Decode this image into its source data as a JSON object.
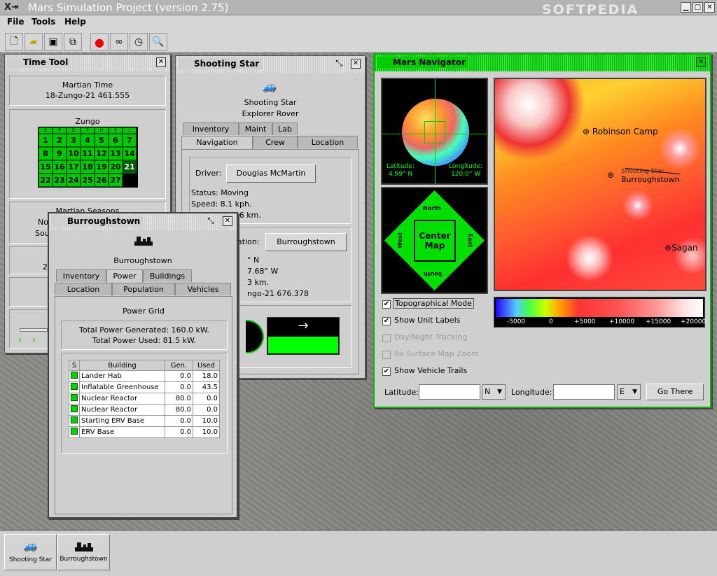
{
  "window": {
    "title": "Mars Simulation Project (version 2.75)",
    "watermark": "SOFTPEDIA"
  },
  "menu": [
    "File",
    "Tools",
    "Help"
  ],
  "toolbar": [
    {
      "icon": "new-file-icon"
    },
    {
      "icon": "open-folder-icon"
    },
    {
      "icon": "save-icon"
    },
    {
      "icon": "save-as-icon"
    },
    {
      "icon": "record-icon"
    },
    {
      "icon": "binoculars-icon"
    },
    {
      "icon": "clock-icon"
    },
    {
      "icon": "document-search-icon"
    }
  ],
  "time_tool": {
    "title": "Time Tool",
    "martian_time_label": "Martian Time",
    "martian_time_value": "18-Zungo-21  461.555",
    "month": "Zungo",
    "weekdays": [
      "S",
      "P",
      "D",
      "T",
      "H",
      "V",
      "J"
    ],
    "days": [
      [
        1,
        2,
        3,
        4,
        5,
        6,
        7
      ],
      [
        8,
        9,
        10,
        11,
        12,
        13,
        14
      ],
      [
        15,
        16,
        17,
        18,
        19,
        20,
        21
      ],
      [
        22,
        23,
        24,
        25,
        26,
        27,
        ""
      ]
    ],
    "current_day": 21,
    "seasons_label": "Martian Seasons",
    "north_abbr": "Nor",
    "south_abbr": "Sout",
    "partial_year": "20"
  },
  "shooting_star": {
    "title": "Shooting Star",
    "name": "Shooting Star",
    "type": "Explorer Rover",
    "tabs_row1": [
      "Inventory",
      "Maint",
      "Lab"
    ],
    "tabs_row2": [
      "Navigation",
      "Crew",
      "Location"
    ],
    "driver_label": "Driver:",
    "driver": "Douglas McMartin",
    "status": "Status: Moving",
    "speed": "Speed: 8.1 kph.",
    "elevation_partial": "Elevation: 1.6 km.",
    "destination_partial": "ation:",
    "destination": "Burroughstown",
    "lat_partial": "° N",
    "lon_partial": "7.68° W",
    "dist_partial": "3 km.",
    "eta_partial": "ngo-21  676.378",
    "direction_arrow": "→"
  },
  "burroughstown": {
    "title": "Burroughstown",
    "name": "Burroughstown",
    "tabs_row1": [
      "Inventory",
      "Power",
      "Buildings"
    ],
    "tabs_row2": [
      "Location",
      "Population",
      "Vehicles"
    ],
    "grid_label": "Power Grid",
    "generated": "Total Power Generated: 160.0 kW.",
    "used": "Total Power Used: 81.5 kW.",
    "table_headers": [
      "S",
      "Building",
      "Gen.",
      "Used"
    ],
    "rows": [
      {
        "building": "Lander Hab",
        "gen": "0.0",
        "used": "18.0"
      },
      {
        "building": "Inflatable Greenhouse",
        "gen": "0.0",
        "used": "43.5"
      },
      {
        "building": "Nuclear Reactor",
        "gen": "80.0",
        "used": "0.0"
      },
      {
        "building": "Nuclear Reactor",
        "gen": "80.0",
        "used": "0.0"
      },
      {
        "building": "Starting ERV Base",
        "gen": "0.0",
        "used": "10.0"
      },
      {
        "building": "ERV Base",
        "gen": "0.0",
        "used": "10.0"
      }
    ]
  },
  "navigator": {
    "title": "Mars Navigator",
    "latitude_label": "Latitude:",
    "latitude_value": "4.99° N",
    "longitude_label": "Longitude:",
    "longitude_value": "120.0° W",
    "compass": {
      "north": "North",
      "south": "South",
      "east": "East",
      "west": "West",
      "center": "Center\nMap"
    },
    "map_labels": [
      "Robinson Camp",
      "Shooting Star",
      "Burroughstown",
      "Sagan"
    ],
    "legend_ticks": [
      "-5000",
      "0",
      "+5000",
      "+10000",
      "+15000",
      "+20000"
    ],
    "options": [
      {
        "label": "Topographical Mode",
        "checked": true,
        "enabled": true
      },
      {
        "label": "Show Unit Labels",
        "checked": true,
        "enabled": true
      },
      {
        "label": "Day/Night Tracking",
        "checked": false,
        "enabled": false
      },
      {
        "label": "8x Surface Map Zoom",
        "checked": false,
        "enabled": false
      },
      {
        "label": "Show Vehicle Trails",
        "checked": true,
        "enabled": true
      }
    ],
    "lat_input_label": "Latitude:",
    "lat_input_value": "",
    "lat_dir": "N",
    "lon_input_label": "Longitude:",
    "lon_input_value": "",
    "lon_dir": "E",
    "go_button": "Go There"
  },
  "taskbar": [
    {
      "label": "Shooting Star",
      "icon": "rover-icon"
    },
    {
      "label": "Burroughstown",
      "icon": "settlement-icon"
    }
  ]
}
